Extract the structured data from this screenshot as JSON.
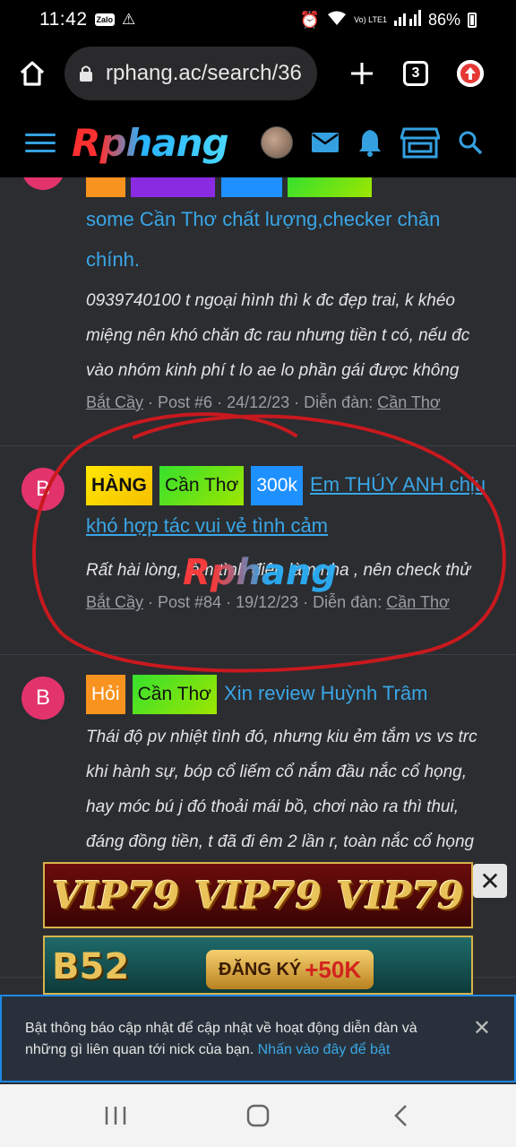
{
  "status": {
    "time": "11:42",
    "zalo": "Zalo",
    "signal_label": "Vo) LTE1",
    "battery": "86%"
  },
  "browser": {
    "url": "rphang.ac/search/36",
    "tabs_count": "3"
  },
  "site": {
    "logo": "Rphang"
  },
  "posts": [
    {
      "id": "post-prev",
      "title_plain": "some Cần Thơ chất lượng,checker chân chính.",
      "snippet": "0939740100 t ngoại hình thì k đc đẹp trai, k khéo miệng nên khó chăn đc rau nhưng tiền t có, nếu đc vào nhóm kinh phí t lo ae lo phần gái được không",
      "author": "Bắt Cầy",
      "post_no": "Post #6",
      "date": "24/12/23",
      "forum_label": "Diễn đàn:",
      "forum": "Cần Thơ"
    },
    {
      "id": "post-84",
      "avatar": "B",
      "tags": [
        "HÀNG",
        "Cần Thơ",
        "300k"
      ],
      "title": "Em THÚY ANH chịu khó hợp tác vui vẻ tình cảm",
      "snippet": "Rất hài lòng, làm tình điên làm nha , nên check thử",
      "author": "Bắt Cầy",
      "post_no": "Post #84",
      "date": "19/12/23",
      "forum_label": "Diễn đàn:",
      "forum": "Cần Thơ"
    },
    {
      "id": "post-hoi",
      "avatar": "B",
      "tags": [
        "Hỏi",
        "Cần Thơ"
      ],
      "title": "Xin review Huỳnh Trâm",
      "snippet": "Thái độ pv nhiệt tình đó, nhưng kiu ẻm tắm vs vs trc khi hành sự, bóp cổ liếm cổ nắm đầu nắc cổ họng, hay móc bú j đó thoải mái bồ, chơi nào ra thì thui, đáng đồng tiền, t đã đi êm 2 lần r, toàn nắc cổ họng"
    }
  ],
  "watermark": "Rphang",
  "ads": {
    "vip": [
      "VIP79",
      "VIP79",
      "VIP79"
    ],
    "b52": "B52",
    "register": "ĐĂNG KÝ",
    "bonus": "+50K"
  },
  "notification": {
    "text": "Bật thông báo cập nhật để cập nhật về hoạt động diễn đàn và những gì liên quan tới nick của bạn.",
    "link": "Nhấn vào đây để bật"
  }
}
